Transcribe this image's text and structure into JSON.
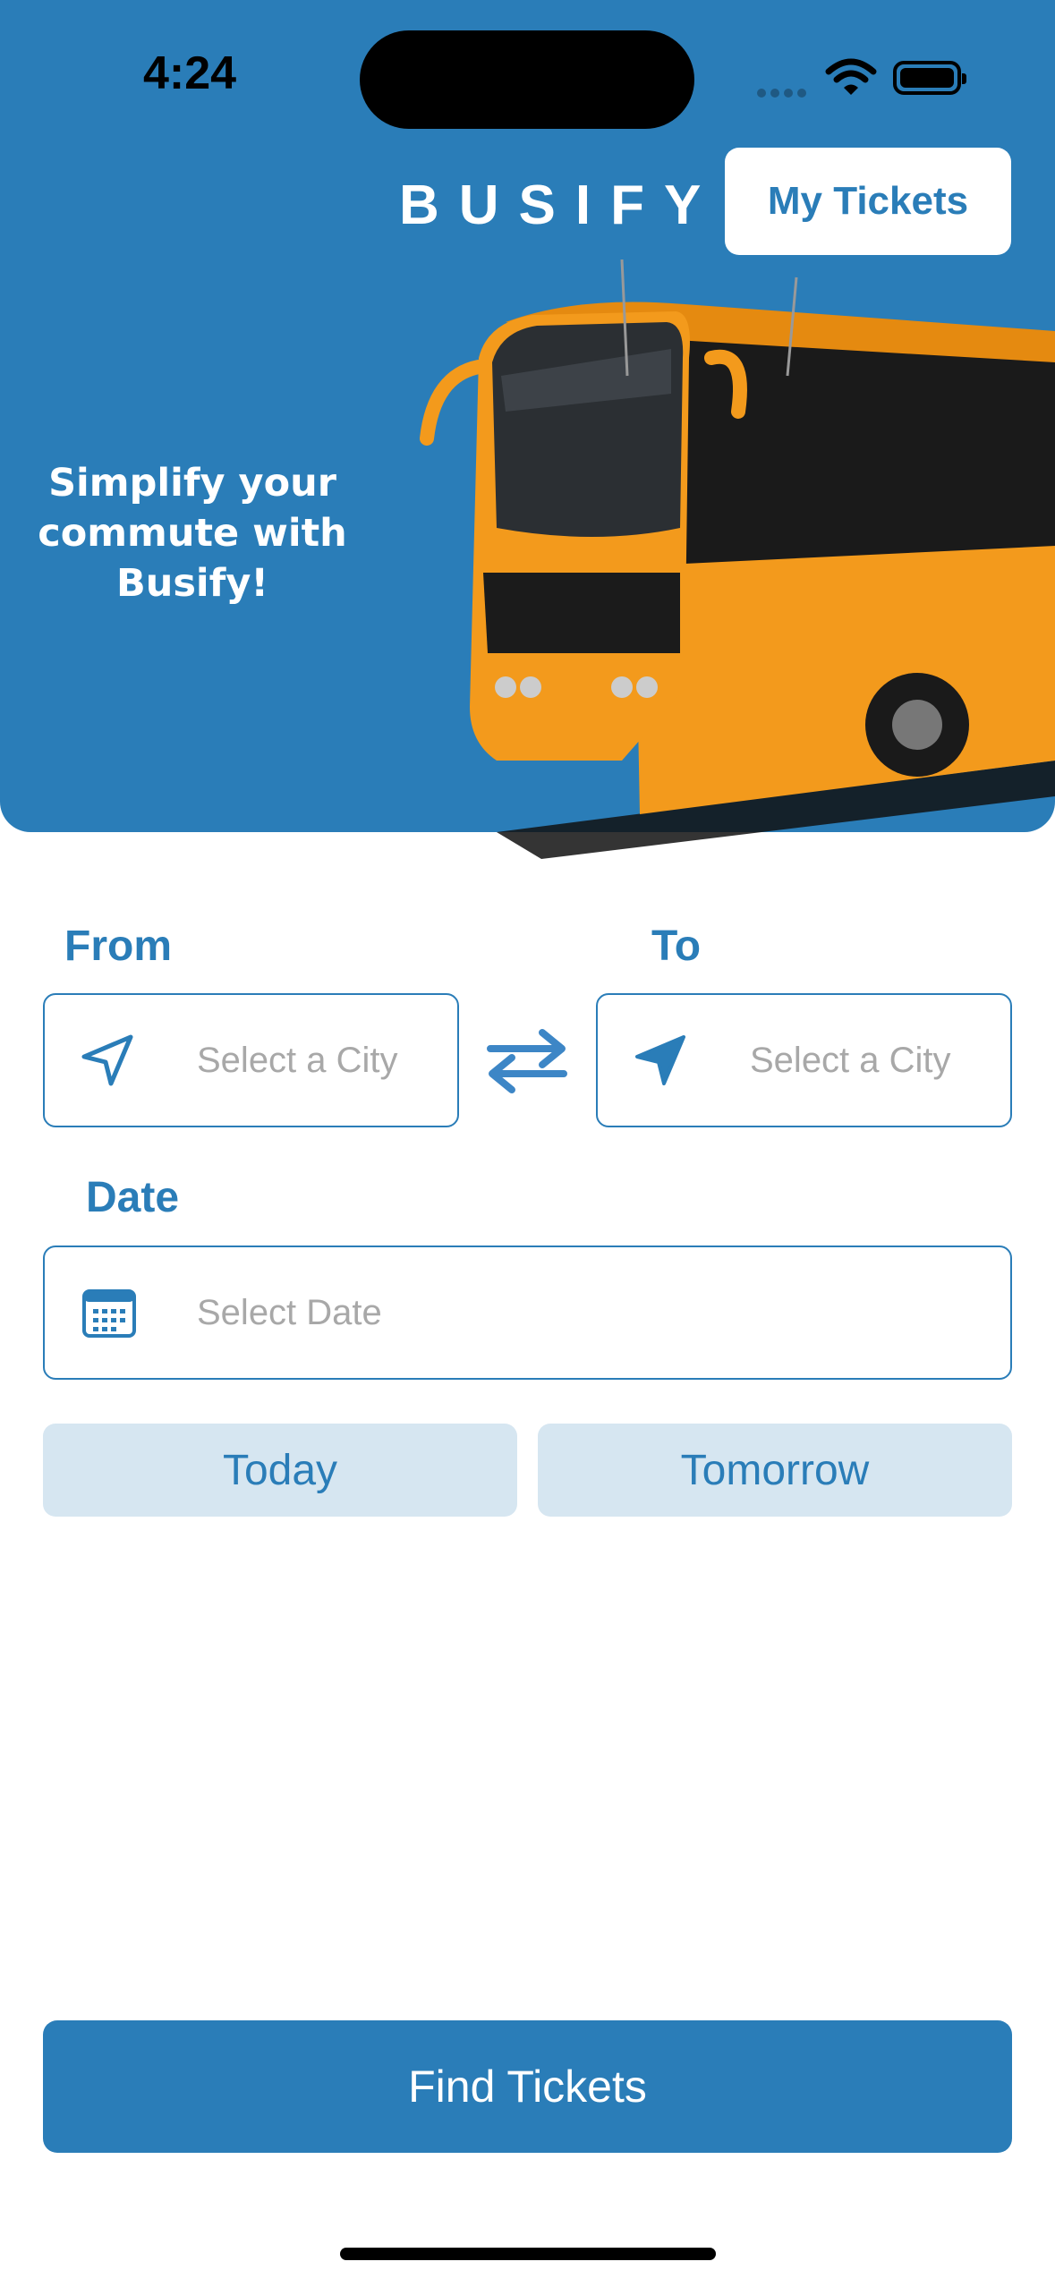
{
  "status_bar": {
    "time": "4:24"
  },
  "header": {
    "brand": "BUSIFY",
    "my_tickets_label": "My Tickets"
  },
  "hero": {
    "tagline_line1": "Simplify your",
    "tagline_line2": "commute with",
    "tagline_line3": "Busify!"
  },
  "form": {
    "from_label": "From",
    "to_label": "To",
    "from_placeholder": "Select a City",
    "to_placeholder": "Select a City",
    "date_label": "Date",
    "date_placeholder": "Select Date",
    "today_label": "Today",
    "tomorrow_label": "Tomorrow"
  },
  "actions": {
    "find_label": "Find Tickets"
  },
  "icons": {
    "from": "navigation-arrow-outline-icon",
    "to": "navigation-arrow-filled-icon",
    "swap": "swap-arrows-icon",
    "date": "calendar-icon"
  },
  "colors": {
    "primary": "#2a7db8",
    "quick_bg": "#d6e6f1",
    "placeholder": "#a8a8a8",
    "bus": "#f39a1c"
  }
}
